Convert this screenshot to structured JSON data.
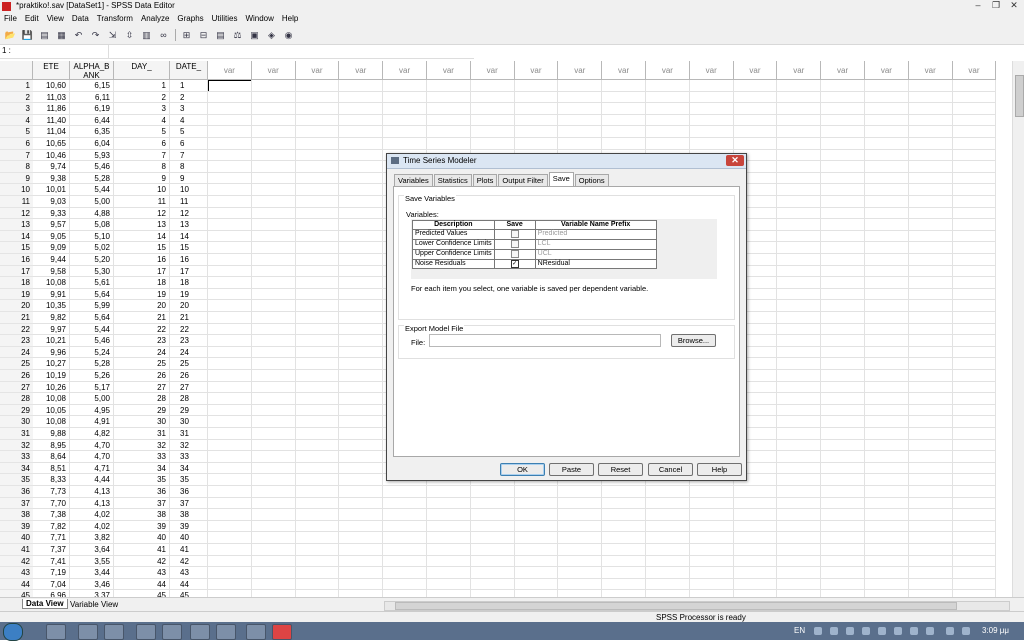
{
  "window": {
    "title": "*praktiko!.sav [DataSet1] - SPSS Data Editor"
  },
  "menu": [
    "File",
    "Edit",
    "View",
    "Data",
    "Transform",
    "Analyze",
    "Graphs",
    "Utilities",
    "Window",
    "Help"
  ],
  "cell_ref": "1 :",
  "columns": [
    {
      "name": "ETE",
      "line2": ""
    },
    {
      "name": "ALPHA_B",
      "line2": "ANK"
    },
    {
      "name": "DAY_",
      "line2": ""
    },
    {
      "name": "DATE_",
      "line2": ""
    }
  ],
  "var_label": "var",
  "rows": [
    [
      "10,60",
      "6,15",
      "1",
      "1"
    ],
    [
      "11,03",
      "6,11",
      "2",
      "2"
    ],
    [
      "11,86",
      "6,19",
      "3",
      "3"
    ],
    [
      "11,40",
      "6,44",
      "4",
      "4"
    ],
    [
      "11,04",
      "6,35",
      "5",
      "5"
    ],
    [
      "10,65",
      "6,04",
      "6",
      "6"
    ],
    [
      "10,46",
      "5,93",
      "7",
      "7"
    ],
    [
      "9,74",
      "5,46",
      "8",
      "8"
    ],
    [
      "9,38",
      "5,28",
      "9",
      "9"
    ],
    [
      "10,01",
      "5,44",
      "10",
      "10"
    ],
    [
      "9,03",
      "5,00",
      "11",
      "11"
    ],
    [
      "9,33",
      "4,88",
      "12",
      "12"
    ],
    [
      "9,57",
      "5,08",
      "13",
      "13"
    ],
    [
      "9,05",
      "5,10",
      "14",
      "14"
    ],
    [
      "9,09",
      "5,02",
      "15",
      "15"
    ],
    [
      "9,44",
      "5,20",
      "16",
      "16"
    ],
    [
      "9,58",
      "5,30",
      "17",
      "17"
    ],
    [
      "10,08",
      "5,61",
      "18",
      "18"
    ],
    [
      "9,91",
      "5,64",
      "19",
      "19"
    ],
    [
      "10,35",
      "5,99",
      "20",
      "20"
    ],
    [
      "9,82",
      "5,64",
      "21",
      "21"
    ],
    [
      "9,97",
      "5,44",
      "22",
      "22"
    ],
    [
      "10,21",
      "5,46",
      "23",
      "23"
    ],
    [
      "9,96",
      "5,24",
      "24",
      "24"
    ],
    [
      "10,27",
      "5,28",
      "25",
      "25"
    ],
    [
      "10,19",
      "5,26",
      "26",
      "26"
    ],
    [
      "10,26",
      "5,17",
      "27",
      "27"
    ],
    [
      "10,08",
      "5,00",
      "28",
      "28"
    ],
    [
      "10,05",
      "4,95",
      "29",
      "29"
    ],
    [
      "10,08",
      "4,91",
      "30",
      "30"
    ],
    [
      "9,88",
      "4,82",
      "31",
      "31"
    ],
    [
      "8,95",
      "4,70",
      "32",
      "32"
    ],
    [
      "8,64",
      "4,70",
      "33",
      "33"
    ],
    [
      "8,51",
      "4,71",
      "34",
      "34"
    ],
    [
      "8,33",
      "4,44",
      "35",
      "35"
    ],
    [
      "7,73",
      "4,13",
      "36",
      "36"
    ],
    [
      "7,70",
      "4,13",
      "37",
      "37"
    ],
    [
      "7,38",
      "4,02",
      "38",
      "38"
    ],
    [
      "7,82",
      "4,02",
      "39",
      "39"
    ],
    [
      "7,71",
      "3,82",
      "40",
      "40"
    ],
    [
      "7,37",
      "3,64",
      "41",
      "41"
    ],
    [
      "7,41",
      "3,55",
      "42",
      "42"
    ],
    [
      "7,19",
      "3,44",
      "43",
      "43"
    ],
    [
      "7,04",
      "3,46",
      "44",
      "44"
    ],
    [
      "6,96",
      "3,37",
      "45",
      "45"
    ]
  ],
  "bottom_tabs": {
    "data_view": "Data View",
    "variable_view": "Variable View"
  },
  "status": "SPSS Processor is ready",
  "taskbar": {
    "lang": "EN",
    "clock": "3:09 μμ"
  },
  "dialog": {
    "title": "Time Series Modeler",
    "tabs": [
      "Variables",
      "Statistics",
      "Plots",
      "Output Filter",
      "Save",
      "Options"
    ],
    "active_tab": "Save",
    "save_group": "Save Variables",
    "variables_label": "Variables:",
    "table_headers": [
      "Description",
      "Save",
      "Variable Name Prefix"
    ],
    "table_rows": [
      {
        "desc": "Predicted Values",
        "checked": false,
        "prefix": "Predicted"
      },
      {
        "desc": "Lower Confidence Limits",
        "checked": false,
        "prefix": "LCL"
      },
      {
        "desc": "Upper Confidence Limits",
        "checked": false,
        "prefix": "UCL"
      },
      {
        "desc": "Noise Residuals",
        "checked": true,
        "prefix": "NResidual"
      }
    ],
    "note": "For each item you select, one variable is saved per dependent variable.",
    "export_group": "Export Model File",
    "file_label": "File:",
    "file_value": "",
    "buttons": {
      "browse": "Browse...",
      "ok": "OK",
      "paste": "Paste",
      "reset": "Reset",
      "cancel": "Cancel",
      "help": "Help"
    }
  }
}
